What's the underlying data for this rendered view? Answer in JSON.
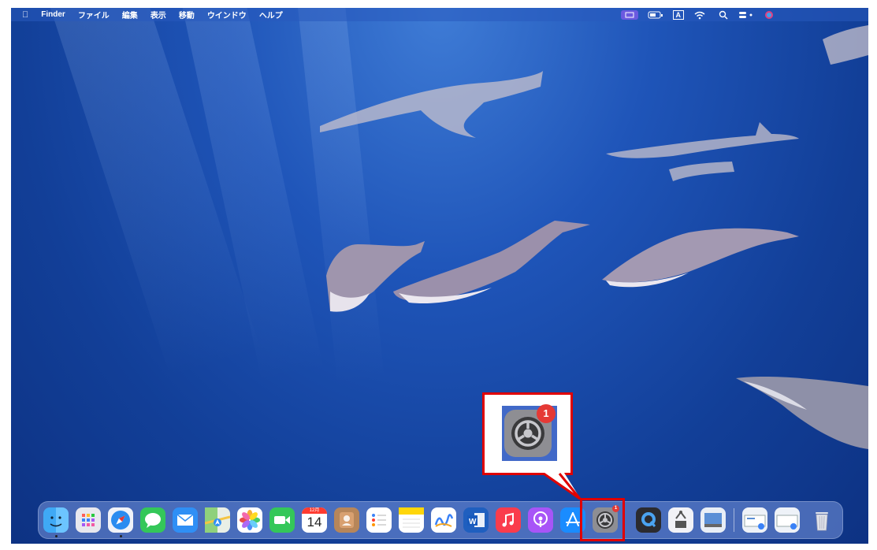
{
  "menubar": {
    "items": [
      "Finder",
      "ファイル",
      "編集",
      "表示",
      "移動",
      "ウインドウ",
      "ヘルプ"
    ],
    "input_mode": "A"
  },
  "callout": {
    "app": "System Settings",
    "badge": "1"
  },
  "dock": {
    "calendar_month": "12月",
    "calendar_day": "14",
    "settings_badge": "1",
    "apps": [
      "Finder",
      "Launchpad",
      "Safari",
      "Messages",
      "Mail",
      "Maps",
      "Photos",
      "FaceTime",
      "Calendar",
      "Contacts",
      "Reminders",
      "Notes",
      "Freeform",
      "Microsoft Word",
      "Music",
      "Podcasts",
      "App Store",
      "System Settings",
      "QuickTime Player",
      "Migration Assistant",
      "Preview",
      "Downloads",
      "Documents",
      "Trash"
    ]
  },
  "colors": {
    "highlight": "#e00000",
    "badge": "#e53935"
  }
}
